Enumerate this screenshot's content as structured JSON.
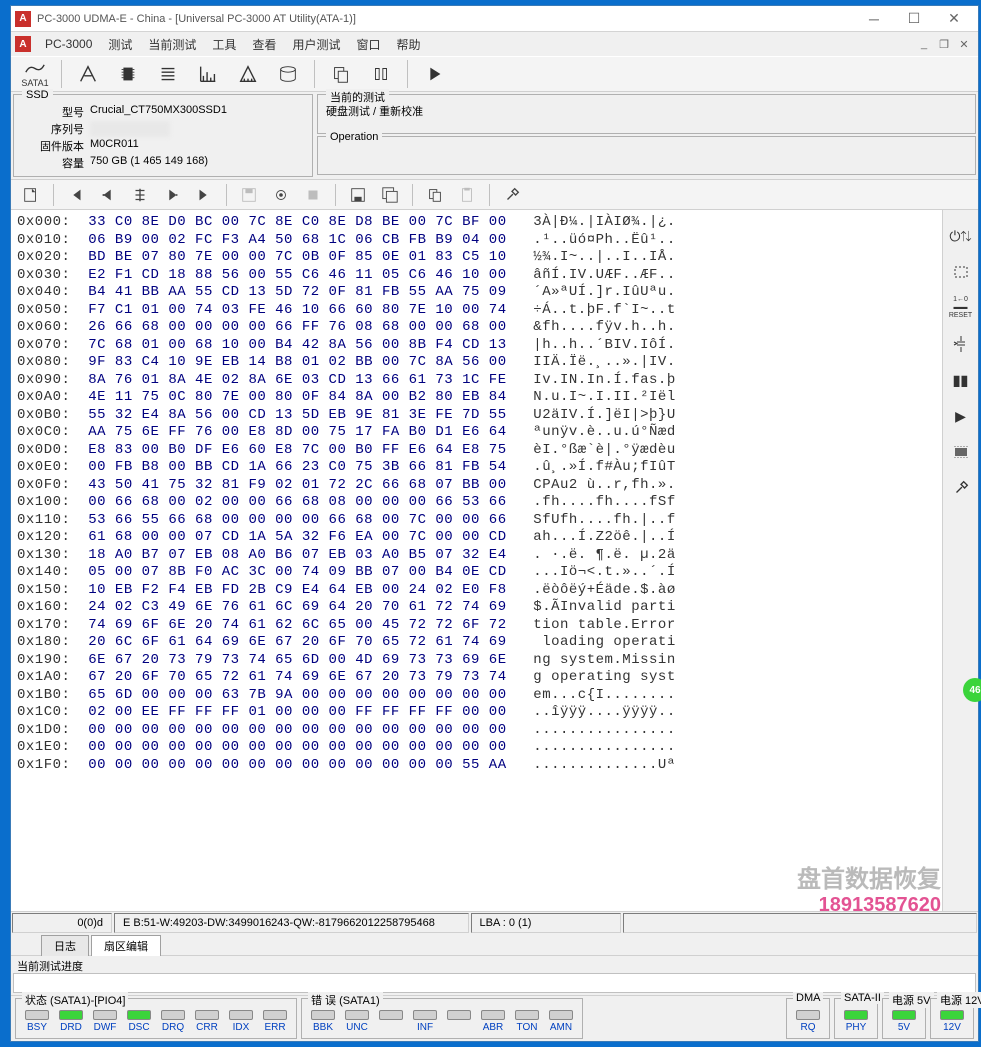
{
  "titlebar": {
    "icon_text": "A",
    "title": "PC-3000 UDMA-E - China - [Universal PC-3000 AT Utility(ATA-1)]"
  },
  "menubar": {
    "icon_text": "A",
    "app": "PC-3000",
    "items": [
      "测试",
      "当前测试",
      "工具",
      "查看",
      "用户测试",
      "窗口",
      "帮助"
    ]
  },
  "toolbar1": {
    "sata_label": "SATA1"
  },
  "info": {
    "fieldset": "SSD",
    "rows": [
      {
        "label": "型号",
        "value": "Crucial_CT750MX300SSD1"
      },
      {
        "label": "序列号",
        "value": ""
      },
      {
        "label": "固件版本",
        "value": "M0CR011"
      },
      {
        "label": "容量",
        "value": "750 GB (1 465 149 168)"
      }
    ],
    "current_test_label": "当前的测试",
    "current_test_value": "硬盘测试 / 重新校准",
    "operation_label": "Operation"
  },
  "hex": {
    "rows": [
      {
        "off": "0x000:",
        "b": "33 C0 8E D0 BC 00 7C 8E C0 8E D8 BE 00 7C BF 00",
        "a": "3À|Đ¼.|IÀIØ¾.|¿."
      },
      {
        "off": "0x010:",
        "b": "06 B9 00 02 FC F3 A4 50 68 1C 06 CB FB B9 04 00",
        "a": ".¹..üó¤Ph..Ëû¹.."
      },
      {
        "off": "0x020:",
        "b": "BD BE 07 80 7E 00 00 7C 0B 0F 85 0E 01 83 C5 10",
        "a": "½¾.I~..|..I..IÅ."
      },
      {
        "off": "0x030:",
        "b": "E2 F1 CD 18 88 56 00 55 C6 46 11 05 C6 46 10 00",
        "a": "âñÍ.IV.UÆF..ÆF.."
      },
      {
        "off": "0x040:",
        "b": "B4 41 BB AA 55 CD 13 5D 72 0F 81 FB 55 AA 75 09",
        "a": "´A»ªUÍ.]r.IûUªu."
      },
      {
        "off": "0x050:",
        "b": "F7 C1 01 00 74 03 FE 46 10 66 60 80 7E 10 00 74",
        "a": "÷Á..t.þF.f`I~..t"
      },
      {
        "off": "0x060:",
        "b": "26 66 68 00 00 00 00 66 FF 76 08 68 00 00 68 00",
        "a": "&fh....fÿv.h..h."
      },
      {
        "off": "0x070:",
        "b": "7C 68 01 00 68 10 00 B4 42 8A 56 00 8B F4 CD 13",
        "a": "|h..h..´BIV.IôÍ."
      },
      {
        "off": "0x080:",
        "b": "9F 83 C4 10 9E EB 14 B8 01 02 BB 00 7C 8A 56 00",
        "a": "IIÄ.Ïë.¸..».|IV."
      },
      {
        "off": "0x090:",
        "b": "8A 76 01 8A 4E 02 8A 6E 03 CD 13 66 61 73 1C FE",
        "a": "Iv.IN.In.Í.fas.þ"
      },
      {
        "off": "0x0A0:",
        "b": "4E 11 75 0C 80 7E 00 80 0F 84 8A 00 B2 80 EB 84",
        "a": "N.u.I~.I.II.²Iël"
      },
      {
        "off": "0x0B0:",
        "b": "55 32 E4 8A 56 00 CD 13 5D EB 9E 81 3E FE 7D 55",
        "a": "U2äIV.Í.]ëI|>þ}U"
      },
      {
        "off": "0x0C0:",
        "b": "AA 75 6E FF 76 00 E8 8D 00 75 17 FA B0 D1 E6 64",
        "a": "ªunÿv.è..u.ú°Ñæd"
      },
      {
        "off": "0x0D0:",
        "b": "E8 83 00 B0 DF E6 60 E8 7C 00 B0 FF E6 64 E8 75",
        "a": "èI.°ßæ`è|.°ÿædèu"
      },
      {
        "off": "0x0E0:",
        "b": "00 FB B8 00 BB CD 1A 66 23 C0 75 3B 66 81 FB 54",
        "a": ".û¸.»Í.f#Àu;fIûT"
      },
      {
        "off": "0x0F0:",
        "b": "43 50 41 75 32 81 F9 02 01 72 2C 66 68 07 BB 00",
        "a": "CPAu2 ù..r,fh.»."
      },
      {
        "off": "0x100:",
        "b": "00 66 68 00 02 00 00 66 68 08 00 00 00 66 53 66",
        "a": ".fh....fh....fSf"
      },
      {
        "off": "0x110:",
        "b": "53 66 55 66 68 00 00 00 00 66 68 00 7C 00 00 66",
        "a": "SfUfh....fh.|..f"
      },
      {
        "off": "0x120:",
        "b": "61 68 00 00 07 CD 1A 5A 32 F6 EA 00 7C 00 00 CD",
        "a": "ah...Í.Z2öê.|..Í"
      },
      {
        "off": "0x130:",
        "b": "18 A0 B7 07 EB 08 A0 B6 07 EB 03 A0 B5 07 32 E4",
        "a": ". ·.ë. ¶.ë. µ.2ä"
      },
      {
        "off": "0x140:",
        "b": "05 00 07 8B F0 AC 3C 00 74 09 BB 07 00 B4 0E CD",
        "a": "...Iö¬<.t.»..´.Í"
      },
      {
        "off": "0x150:",
        "b": "10 EB F2 F4 EB FD 2B C9 E4 64 EB 00 24 02 E0 F8",
        "a": ".ëòôëý+Éäde.$.àø"
      },
      {
        "off": "0x160:",
        "b": "24 02 C3 49 6E 76 61 6C 69 64 20 70 61 72 74 69",
        "a": "$.ÃInvalid parti"
      },
      {
        "off": "0x170:",
        "b": "74 69 6F 6E 20 74 61 62 6C 65 00 45 72 72 6F 72",
        "a": "tion table.Error"
      },
      {
        "off": "0x180:",
        "b": "20 6C 6F 61 64 69 6E 67 20 6F 70 65 72 61 74 69",
        "a": " loading operati"
      },
      {
        "off": "0x190:",
        "b": "6E 67 20 73 79 73 74 65 6D 00 4D 69 73 73 69 6E",
        "a": "ng system.Missin"
      },
      {
        "off": "0x1A0:",
        "b": "67 20 6F 70 65 72 61 74 69 6E 67 20 73 79 73 74",
        "a": "g operating syst"
      },
      {
        "off": "0x1B0:",
        "b": "65 6D 00 00 00 63 7B 9A 00 00 00 00 00 00 00 00",
        "a": "em...c{I........"
      },
      {
        "off": "0x1C0:",
        "b": "02 00 EE FF FF FF 01 00 00 00 FF FF FF FF 00 00",
        "a": "..îÿÿÿ....ÿÿÿÿ.."
      },
      {
        "off": "0x1D0:",
        "b": "00 00 00 00 00 00 00 00 00 00 00 00 00 00 00 00",
        "a": "................"
      },
      {
        "off": "0x1E0:",
        "b": "00 00 00 00 00 00 00 00 00 00 00 00 00 00 00 00",
        "a": "................"
      },
      {
        "off": "0x1F0:",
        "b": "00 00 00 00 00 00 00 00 00 00 00 00 00 00 55 AA",
        "a": "..............Uª"
      }
    ]
  },
  "status": {
    "cell1": "0(0)d",
    "cell2": "E B:51-W:49203-DW:3499016243-QW:-8179662012258795468",
    "cell3": "LBA : 0 (1)"
  },
  "tabs": [
    "日志",
    "扇区编辑"
  ],
  "progress_label": "当前测试进度",
  "bottom": {
    "state_label": "状态 (SATA1)-[PIO4]",
    "state_items": [
      {
        "l": "BSY",
        "on": false
      },
      {
        "l": "DRD",
        "on": true
      },
      {
        "l": "DWF",
        "on": false
      },
      {
        "l": "DSC",
        "on": true
      },
      {
        "l": "DRQ",
        "on": false
      },
      {
        "l": "CRR",
        "on": false
      },
      {
        "l": "IDX",
        "on": false
      },
      {
        "l": "ERR",
        "on": false
      }
    ],
    "error_label": "错 误 (SATA1)",
    "error_items": [
      {
        "l": "BBK",
        "on": false
      },
      {
        "l": "UNC",
        "on": false
      },
      {
        "l": "",
        "on": false
      },
      {
        "l": "INF",
        "on": false
      },
      {
        "l": "",
        "on": false
      },
      {
        "l": "ABR",
        "on": false
      },
      {
        "l": "TON",
        "on": false
      },
      {
        "l": "AMN",
        "on": false
      }
    ],
    "dma_label": "DMA",
    "dma_items": [
      {
        "l": "RQ",
        "on": false
      }
    ],
    "sata2_label": "SATA-II",
    "sata2_items": [
      {
        "l": "PHY",
        "on": true
      }
    ],
    "p5_label": "电源 5V",
    "p5_items": [
      {
        "l": "5V",
        "on": true
      }
    ],
    "p12_label": "电源 12V",
    "p12_items": [
      {
        "l": "12V",
        "on": true
      }
    ]
  },
  "watermark": {
    "l1": "盘首数据恢复",
    "l2": "18913587620"
  },
  "badge": "46"
}
